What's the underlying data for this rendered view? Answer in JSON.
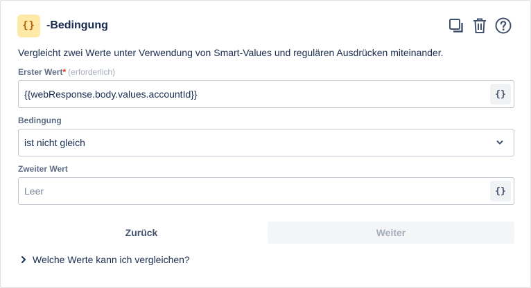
{
  "header": {
    "node_icon": "{}",
    "title": "-Bedingung",
    "actions": [
      "duplicate-icon",
      "trash-icon",
      "help-icon"
    ]
  },
  "description": "Vergleicht zwei Werte unter Verwendung von Smart-Values und regulären Ausdrücken miteinander.",
  "first_value": {
    "label": "Erster Wert",
    "required_mark": "*",
    "required_hint": "(erforderlich)",
    "value": "{{webResponse.body.values.accountId}}",
    "smart_button": "{}"
  },
  "condition": {
    "label": "Bedingung",
    "selected": "ist nicht gleich"
  },
  "second_value": {
    "label": "Zweiter Wert",
    "placeholder": "Leer",
    "smart_button": "{}"
  },
  "buttons": {
    "back": "Zurück",
    "next": "Weiter"
  },
  "faq": {
    "label": "Welche Werte kann ich vergleichen?"
  },
  "colors": {
    "accent_icon_bg": "#ffe9a8",
    "accent_icon_fg": "#b65c02",
    "text": "#172b4d",
    "border": "#c1c7d0"
  }
}
